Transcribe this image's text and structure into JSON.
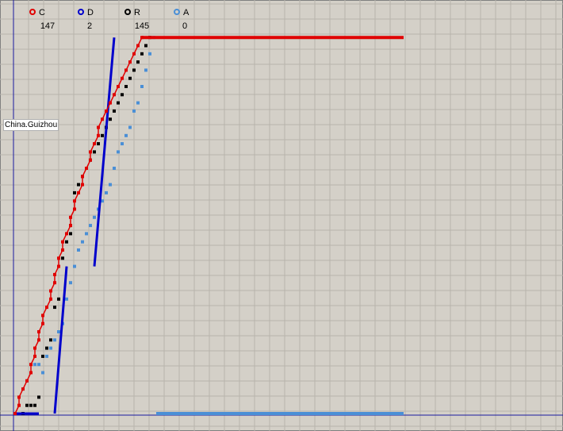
{
  "chart_data": {
    "type": "scatter",
    "title": "",
    "xlabel": "",
    "ylabel": "",
    "grid": true,
    "legend_placement": "top-left",
    "region_label": "China.Guizhou",
    "series": [
      {
        "name": "C",
        "color": "#e00000",
        "marker": "square",
        "final_value": "147",
        "points": [
          [
            0,
            0
          ],
          [
            1,
            1
          ],
          [
            1,
            2
          ],
          [
            2,
            3
          ],
          [
            3,
            4
          ],
          [
            4,
            5
          ],
          [
            4,
            6
          ],
          [
            5,
            7
          ],
          [
            5,
            8
          ],
          [
            6,
            9
          ],
          [
            6,
            10
          ],
          [
            7,
            11
          ],
          [
            7,
            12
          ],
          [
            8,
            13
          ],
          [
            9,
            14
          ],
          [
            9,
            15
          ],
          [
            10,
            16
          ],
          [
            10,
            17
          ],
          [
            11,
            18
          ],
          [
            11,
            19
          ],
          [
            12,
            20
          ],
          [
            12,
            21
          ],
          [
            13,
            22
          ],
          [
            14,
            23
          ],
          [
            14,
            24
          ],
          [
            15,
            25
          ],
          [
            15,
            26
          ],
          [
            16,
            27
          ],
          [
            17,
            28
          ],
          [
            17,
            29
          ],
          [
            18,
            30
          ],
          [
            19,
            31
          ],
          [
            19,
            32
          ],
          [
            20,
            33
          ],
          [
            21,
            34
          ],
          [
            21,
            35
          ],
          [
            22,
            36
          ],
          [
            23,
            37
          ],
          [
            24,
            38
          ],
          [
            25,
            39
          ],
          [
            26,
            40
          ],
          [
            27,
            41
          ],
          [
            28,
            42
          ],
          [
            29,
            43
          ],
          [
            30,
            44
          ],
          [
            31,
            45
          ],
          [
            32,
            46
          ]
        ],
        "line_x_end": 98
      },
      {
        "name": "D",
        "color": "#0000cc",
        "marker": "square",
        "final_value": "2",
        "points": [
          [
            0,
            0
          ],
          [
            6,
            0
          ],
          [
            10,
            0
          ],
          [
            13,
            18
          ],
          [
            20,
            18
          ],
          [
            25,
            46
          ],
          [
            33,
            46
          ],
          [
            40,
            46
          ]
        ]
      },
      {
        "name": "R",
        "color": "#000000",
        "marker": "square",
        "final_value": "145",
        "points": [
          [
            2,
            0
          ],
          [
            3,
            1
          ],
          [
            4,
            1
          ],
          [
            5,
            1
          ],
          [
            6,
            2
          ],
          [
            7,
            7
          ],
          [
            8,
            8
          ],
          [
            9,
            9
          ],
          [
            10,
            13
          ],
          [
            11,
            14
          ],
          [
            12,
            19
          ],
          [
            13,
            21
          ],
          [
            14,
            22
          ],
          [
            14,
            23
          ],
          [
            15,
            27
          ],
          [
            16,
            28
          ],
          [
            17,
            29
          ],
          [
            18,
            30
          ],
          [
            19,
            31
          ],
          [
            20,
            32
          ],
          [
            21,
            33
          ],
          [
            22,
            34
          ],
          [
            23,
            35
          ],
          [
            24,
            36
          ],
          [
            25,
            37
          ],
          [
            26,
            38
          ],
          [
            27,
            39
          ],
          [
            28,
            40
          ],
          [
            29,
            41
          ],
          [
            30,
            42
          ],
          [
            31,
            43
          ],
          [
            32,
            44
          ],
          [
            33,
            45
          ],
          [
            34,
            46
          ]
        ]
      },
      {
        "name": "A",
        "color": "#4a8fd6",
        "marker": "square",
        "final_value": "0",
        "points": [
          [
            0,
            0
          ],
          [
            1,
            2
          ],
          [
            2,
            3
          ],
          [
            3,
            4
          ],
          [
            4,
            5
          ],
          [
            5,
            6
          ],
          [
            6,
            6
          ],
          [
            7,
            5
          ],
          [
            8,
            7
          ],
          [
            9,
            8
          ],
          [
            10,
            9
          ],
          [
            11,
            10
          ],
          [
            12,
            11
          ],
          [
            13,
            14
          ],
          [
            14,
            16
          ],
          [
            15,
            18
          ],
          [
            16,
            20
          ],
          [
            17,
            21
          ],
          [
            18,
            22
          ],
          [
            19,
            23
          ],
          [
            20,
            24
          ],
          [
            21,
            25
          ],
          [
            22,
            26
          ],
          [
            23,
            27
          ],
          [
            24,
            28
          ],
          [
            25,
            30
          ],
          [
            26,
            32
          ],
          [
            27,
            33
          ],
          [
            28,
            34
          ],
          [
            29,
            35
          ],
          [
            30,
            37
          ],
          [
            31,
            38
          ],
          [
            32,
            40
          ],
          [
            33,
            42
          ],
          [
            34,
            44
          ],
          [
            35,
            46
          ],
          [
            36,
            0
          ],
          [
            98,
            0
          ]
        ]
      }
    ]
  }
}
